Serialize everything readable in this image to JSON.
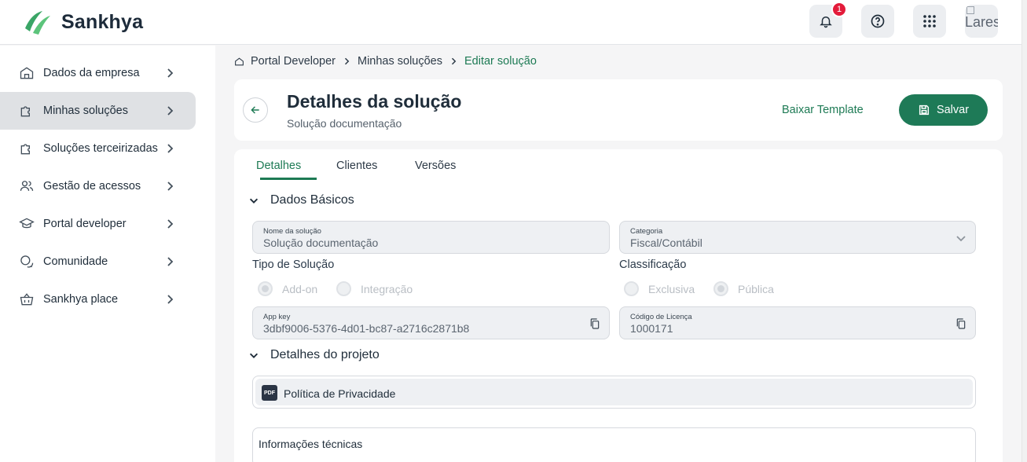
{
  "header": {
    "brand": "Sankhya",
    "notifications_count": "1",
    "avatar_alt": "Lares"
  },
  "sidebar": {
    "items": [
      {
        "label": "Dados da empresa"
      },
      {
        "label": "Minhas soluções"
      },
      {
        "label": "Soluções terceirizadas"
      },
      {
        "label": "Gestão de acessos"
      },
      {
        "label": "Portal developer"
      },
      {
        "label": "Comunidade"
      },
      {
        "label": "Sankhya place"
      }
    ],
    "active_item": "Minhas soluções"
  },
  "breadcrumb": {
    "items": [
      "Portal Developer",
      "Minhas soluções",
      "Editar solução"
    ]
  },
  "page": {
    "title": "Detalhes da solução",
    "subtitle": "Solução documentação",
    "template_link": "Baixar Template",
    "save_label": "Salvar"
  },
  "tabs": [
    "Detalhes",
    "Clientes",
    "Versões"
  ],
  "active_tab": "Detalhes",
  "dados_basicos": {
    "section_title": "Dados Básicos",
    "nome": {
      "label": "Nome da solução",
      "value": "Solução documentação"
    },
    "categoria": {
      "label": "Categoria",
      "value": "Fiscal/Contábil"
    },
    "tipo": {
      "label": "Tipo de Solução",
      "options": [
        "Add-on",
        "Integração"
      ],
      "selected": "Add-on"
    },
    "classificacao": {
      "label": "Classificação",
      "options": [
        "Exclusiva",
        "Pública"
      ],
      "selected": "Pública"
    },
    "app_key": {
      "label": "App key",
      "value": "3dbf9006-5376-4d01-bc87-a2716c2871b8"
    },
    "licenca": {
      "label": "Código de Licença",
      "value": "1000171"
    }
  },
  "detalhes_projeto": {
    "section_title": "Detalhes do projeto",
    "document": {
      "badge": "PDF",
      "label": "Política de Privacidade"
    },
    "tech_info_label": "Informações técnicas"
  },
  "colors": {
    "accent": "#1d7a54",
    "save_button": "#1e7a57",
    "badge": "#e31b3a"
  }
}
